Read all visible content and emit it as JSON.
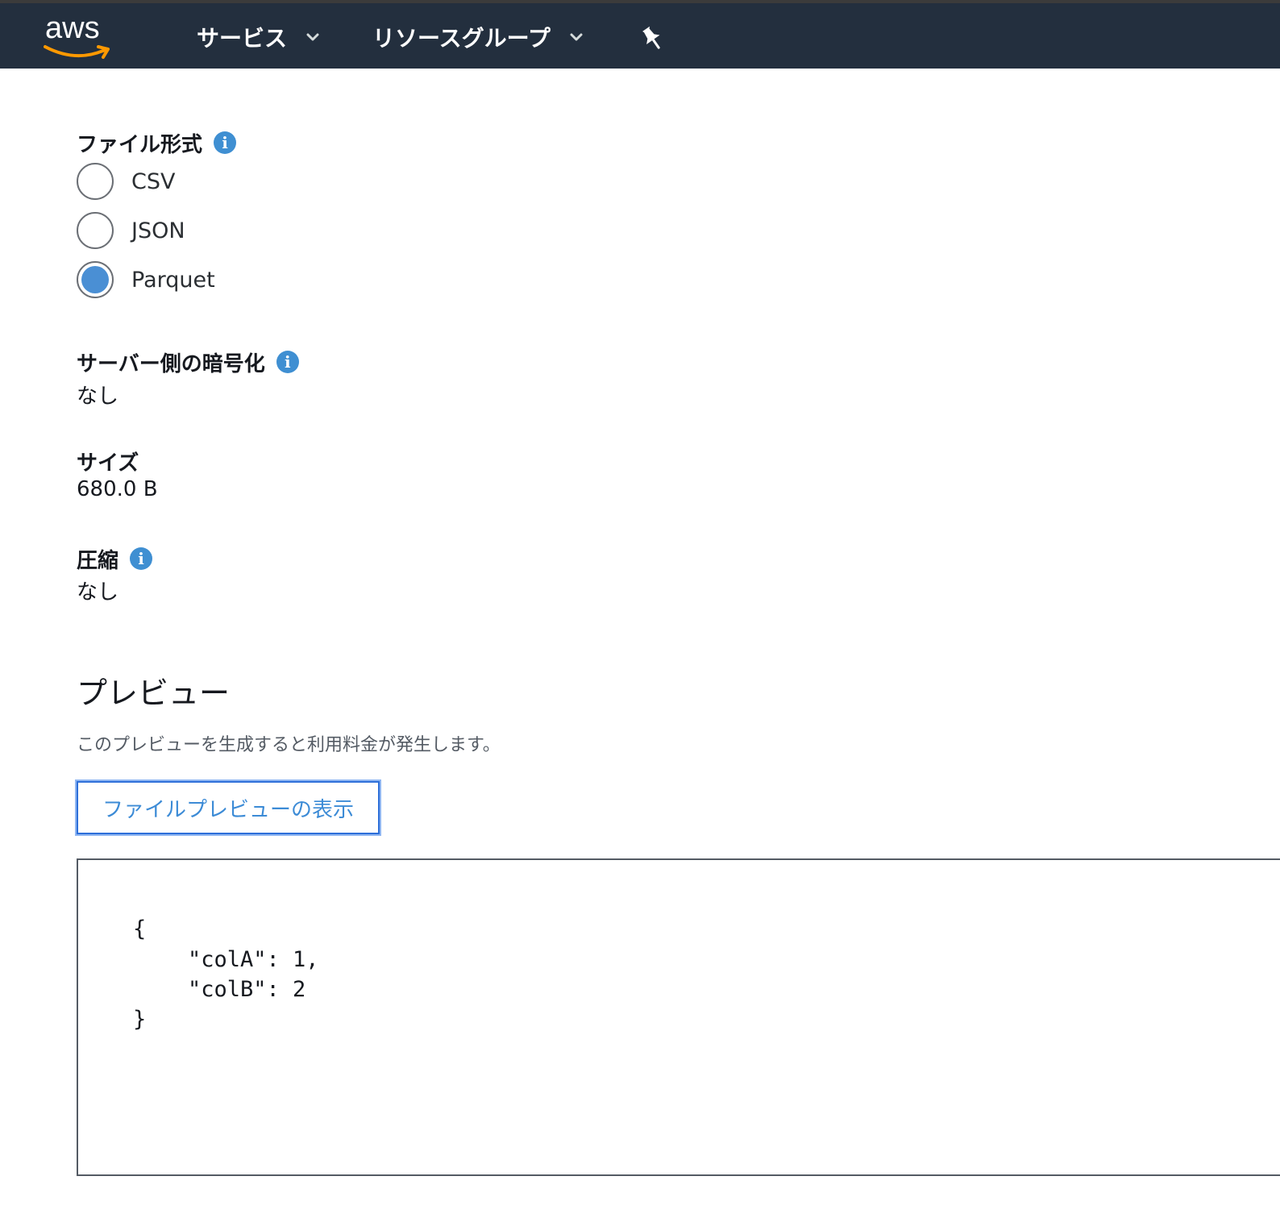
{
  "header": {
    "logo_text": "aws",
    "nav": [
      {
        "label": "サービス"
      },
      {
        "label": "リソースグループ"
      }
    ]
  },
  "file_format": {
    "label": "ファイル形式",
    "options": [
      {
        "label": "CSV",
        "selected": false
      },
      {
        "label": "JSON",
        "selected": false
      },
      {
        "label": "Parquet",
        "selected": true
      }
    ]
  },
  "encryption": {
    "label": "サーバー側の暗号化",
    "value": "なし"
  },
  "size": {
    "label": "サイズ",
    "value": "680.0 B"
  },
  "compression": {
    "label": "圧縮",
    "value": "なし"
  },
  "preview": {
    "title": "プレビュー",
    "note": "このプレビューを生成すると利用料金が発生します。",
    "button_label": "ファイルプレビューの表示",
    "code_lines": [
      "{",
      "\"colA\": 1,",
      "\"colB\": 2",
      "}"
    ]
  },
  "colors": {
    "topbar_bg": "#232f3e",
    "accent": "#3f8fd2",
    "logo_smile": "#f90"
  }
}
